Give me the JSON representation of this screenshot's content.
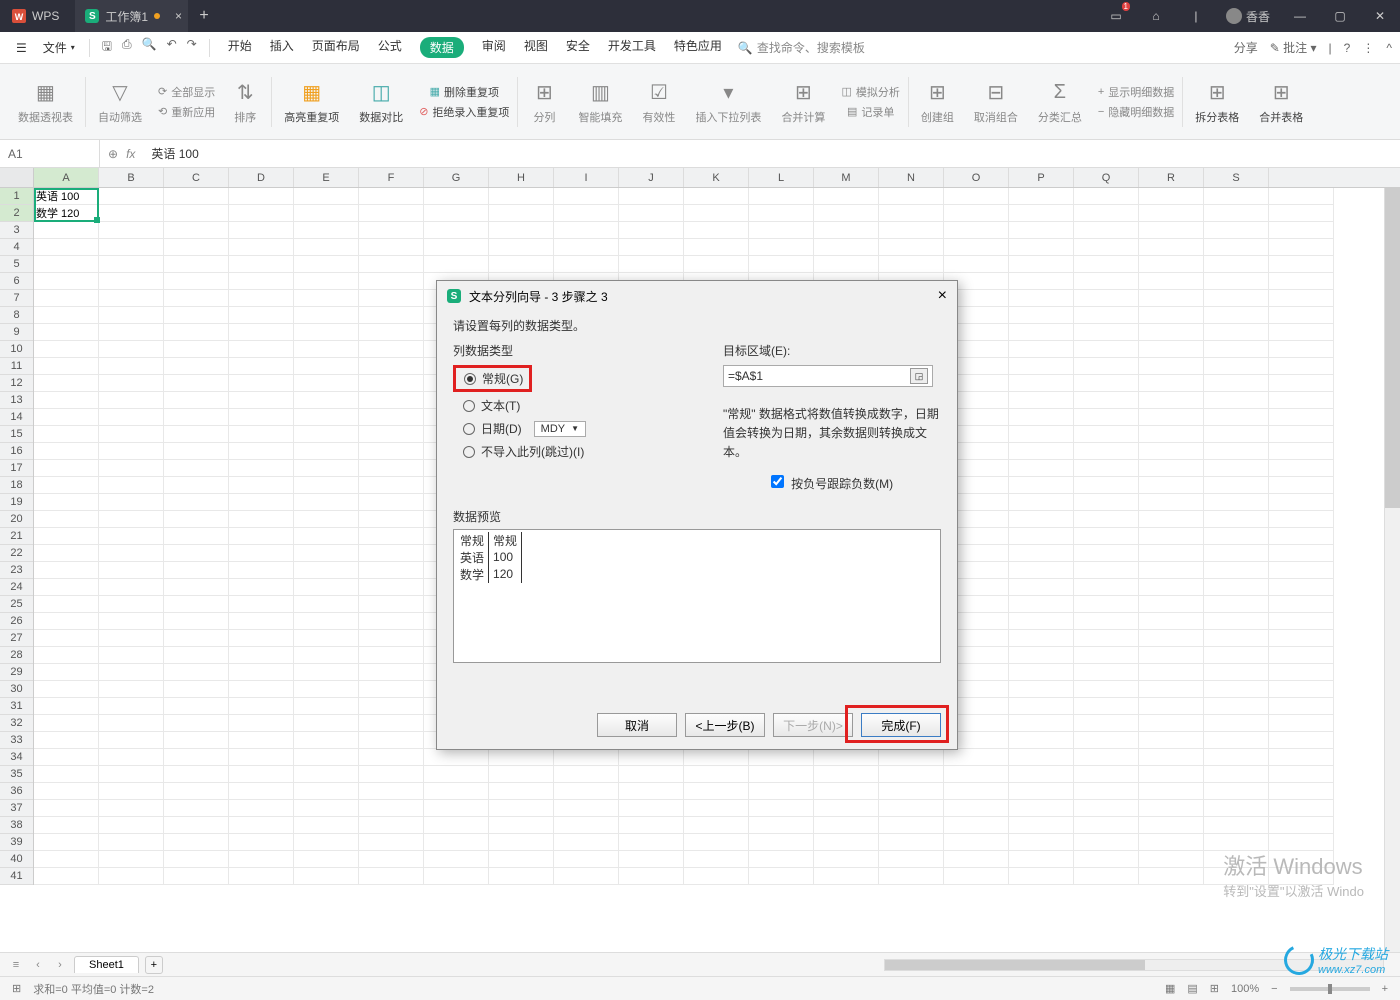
{
  "titlebar": {
    "app": "WPS",
    "tab_name": "工作簿1",
    "user": "香香"
  },
  "menubar": {
    "file": "文件",
    "tabs": [
      "开始",
      "插入",
      "页面布局",
      "公式",
      "数据",
      "审阅",
      "视图",
      "安全",
      "开发工具",
      "特色应用"
    ],
    "active_tab_index": 4,
    "search_placeholder": "查找命令、搜索模板",
    "share": "分享",
    "annotate": "批注"
  },
  "ribbon": {
    "pivot": "数据透视表",
    "autofilter": "自动筛选",
    "show_all": "全部显示",
    "reapply": "重新应用",
    "sort_icon": "↓",
    "sort": "排序",
    "highlight_dup": "高亮重复项",
    "data_compare": "数据对比",
    "remove_dup": "删除重复项",
    "reject_dup": "拒绝录入重复项",
    "text_to_cols": "分列",
    "smart_fill": "智能填充",
    "validity": "有效性",
    "insert_dropdown": "插入下拉列表",
    "consolidate": "合并计算",
    "whatif": "模拟分析",
    "record": "记录单",
    "create_group": "创建组",
    "ungroup": "取消组合",
    "subtotal": "分类汇总",
    "show_detail": "显示明细数据",
    "hide_detail": "隐藏明细数据",
    "split_table": "拆分表格",
    "merge_table": "合并表格"
  },
  "formula": {
    "cell_ref": "A1",
    "value": "英语  100"
  },
  "columns": [
    "A",
    "B",
    "C",
    "D",
    "E",
    "F",
    "G",
    "H",
    "I",
    "J",
    "K",
    "L",
    "M",
    "N",
    "O",
    "P",
    "Q",
    "R",
    "S"
  ],
  "cells": {
    "a1": "英语  100",
    "a2": "数学  120"
  },
  "sheet": {
    "name": "Sheet1"
  },
  "status": {
    "stats": "求和=0   平均值=0   计数=2",
    "zoom": "100%"
  },
  "dialog": {
    "title": "文本分列向导 - 3 步骤之 3",
    "instruction": "请设置每列的数据类型。",
    "col_type_label": "列数据类型",
    "radio_general": "常规(G)",
    "radio_text": "文本(T)",
    "radio_date": "日期(D)",
    "date_format": "MDY",
    "radio_skip": "不导入此列(跳过)(I)",
    "target_label": "目标区域(E):",
    "target_value": "=$A$1",
    "description": "\"常规\" 数据格式将数值转换成数字，日期值会转换为日期，其余数据则转换成文本。",
    "checkbox_label": "按负号跟踪负数(M)",
    "preview_label": "数据预览",
    "preview_headers": [
      "常规",
      "常规"
    ],
    "preview_rows": [
      [
        "英语",
        "100"
      ],
      [
        "数学",
        "120"
      ]
    ],
    "btn_cancel": "取消",
    "btn_back": "<上一步(B)",
    "btn_next": "下一步(N)>",
    "btn_finish": "完成(F)"
  },
  "watermark": {
    "line1": "激活 Windows",
    "line2": "转到\"设置\"以激活 Windo",
    "site1": "极光下载站",
    "site2": "www.xz7.com"
  }
}
